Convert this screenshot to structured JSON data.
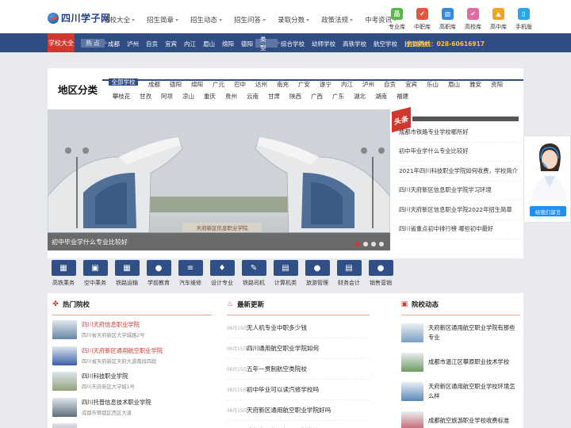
{
  "header": {
    "logo_text": "四川学子网",
    "nav": [
      {
        "label": "学校大全",
        "caret": true
      },
      {
        "label": "招生简章",
        "caret": true
      },
      {
        "label": "招生动态",
        "caret": true
      },
      {
        "label": "招生问答",
        "caret": true
      },
      {
        "label": "录取分数",
        "caret": true
      },
      {
        "label": "政策法规",
        "caret": true
      },
      {
        "label": "中考资讯",
        "caret": true
      }
    ],
    "quicklinks": [
      {
        "label": "专业库",
        "icon": "chart-bars-icon",
        "color": "#5ab84b",
        "glyph": "品"
      },
      {
        "label": "中职库",
        "icon": "checkbox-icon",
        "color": "#e4573e",
        "glyph": "✔"
      },
      {
        "label": "高职库",
        "icon": "building-icon",
        "color": "#2f8be0",
        "glyph": "▥"
      },
      {
        "label": "高校库",
        "icon": "check-list-icon",
        "color": "#e46aa3",
        "glyph": "✔"
      },
      {
        "label": "高中库",
        "icon": "graduation-icon",
        "color": "#f3a51d",
        "glyph": "▲"
      },
      {
        "label": "手机版",
        "icon": "phone-icon",
        "color": "#2aa5e8",
        "glyph": "▯"
      }
    ]
  },
  "strip": {
    "category_tab": "学校大全",
    "hot_label": "热 点",
    "hot_links": [
      "成都",
      "泸州",
      "自贡",
      "宜宾",
      "内江",
      "眉山",
      "绵阳",
      "德阳"
    ],
    "type_label": "类 型",
    "type_links": [
      "综合学校",
      "幼师学校",
      "高铁学校",
      "航空学校",
      "技工学校"
    ],
    "hotline": "咨询热线：028-60616917"
  },
  "region": {
    "title": "地区分类",
    "items": [
      "全部学校",
      "成都",
      "德阳",
      "绵阳",
      "广元",
      "巴中",
      "达州",
      "南充",
      "广安",
      "遂宁",
      "内江",
      "泸州",
      "自贡",
      "宜宾",
      "乐山",
      "眉山",
      "雅安",
      "资阳",
      "攀枝花",
      "甘孜",
      "阿坝",
      "凉山",
      "重庆",
      "贵州",
      "云南",
      "甘肃",
      "陕西",
      "广西",
      "广东",
      "湖北",
      "湖南",
      "福建"
    ]
  },
  "banner": {
    "caption": "初中毕业学什么专业比较好",
    "sign_text": "天府新区信息职业学院"
  },
  "headlines": {
    "tag": "头条",
    "items": [
      "成都市铁路专业学校哪所好",
      "初中毕业学什么专业比较好",
      "2021年四川科技职业学院如何收费，学校简介",
      "四川天府新区信息职业学院学习环境",
      "四川天府新区信息职业学院2022年招生简章",
      "四川省重点初中排行榜 哪些初中最好"
    ]
  },
  "chat": {
    "button": "给我们留言"
  },
  "tiles": [
    {
      "label": "高铁乘务",
      "icon": "train-icon",
      "glyph": "▦"
    },
    {
      "label": "空中乘务",
      "icon": "suitcase-icon",
      "glyph": "▣"
    },
    {
      "label": "铁路运输",
      "icon": "train-icon",
      "glyph": "▦"
    },
    {
      "label": "学前教育",
      "icon": "chat-bubble-icon",
      "glyph": "●"
    },
    {
      "label": "汽车维修",
      "icon": "list-icon",
      "glyph": "≡"
    },
    {
      "label": "设计专业",
      "icon": "microphone-icon",
      "glyph": "♦"
    },
    {
      "label": "铁路司机",
      "icon": "edit-icon",
      "glyph": "✎"
    },
    {
      "label": "计算机类",
      "icon": "calculator-icon",
      "glyph": "▤"
    },
    {
      "label": "旅游管理",
      "icon": "chat-bubble-icon",
      "glyph": "●"
    },
    {
      "label": "财务会计",
      "icon": "calculator-icon",
      "glyph": "▤"
    },
    {
      "label": "销售营销",
      "icon": "chat-bubble-icon",
      "glyph": "●"
    }
  ],
  "hot_schools": {
    "title": "热门院校",
    "items": [
      {
        "name": "四川天府信息职业学院",
        "addr": "四川省天府新区大学城路2号",
        "red": true,
        "thumb": "#6b86a6"
      },
      {
        "name": "四川天府新区通用航空职业学院",
        "addr": "四川省天府新区天府大道南段四段",
        "red": true,
        "thumb": "#3a5fa8"
      },
      {
        "name": "四川科技职业学院",
        "addr": "四川天府新区大学城1号",
        "red": false,
        "thumb": "#8fa37a"
      },
      {
        "name": "四川托普信息技术职业学院",
        "addr": "成都市郫都区西区大道",
        "red": false,
        "thumb": "#5d6f7c"
      },
      {
        "name": "成都华夏旅游商务学校",
        "addr": "",
        "red": true,
        "thumb": "#9a7f69"
      }
    ]
  },
  "latest": {
    "title": "最新更新",
    "items": [
      {
        "date": "06月15日",
        "title": "无人机专业中职多少钱"
      },
      {
        "date": "06月15日",
        "title": "四川通用航空职业学院如何"
      },
      {
        "date": "06月15日",
        "title": "五年一贯制航空类院校"
      },
      {
        "date": "06月15日",
        "title": "初中毕业可以读汽修学校吗"
      },
      {
        "date": "06月15日",
        "title": "天府新区通用航空职业学院好吗"
      },
      {
        "date": "06月15日",
        "title": "成都有哪些五年一贯制学校"
      }
    ]
  },
  "dynamics": {
    "title": "院校动态",
    "items": [
      {
        "title": "天府新区通用航空职业学院有那些专业",
        "thumb": "#7aa0c4"
      },
      {
        "title": "成都市温江区攀原职业技术学校",
        "thumb": "#6d9a5c"
      },
      {
        "title": "天府新区通用航空职业学校环境怎么样",
        "thumb": "#5b87b9"
      },
      {
        "title": "成都航空旅游职业学校收费标准",
        "thumb": "#c25a69"
      }
    ]
  }
}
